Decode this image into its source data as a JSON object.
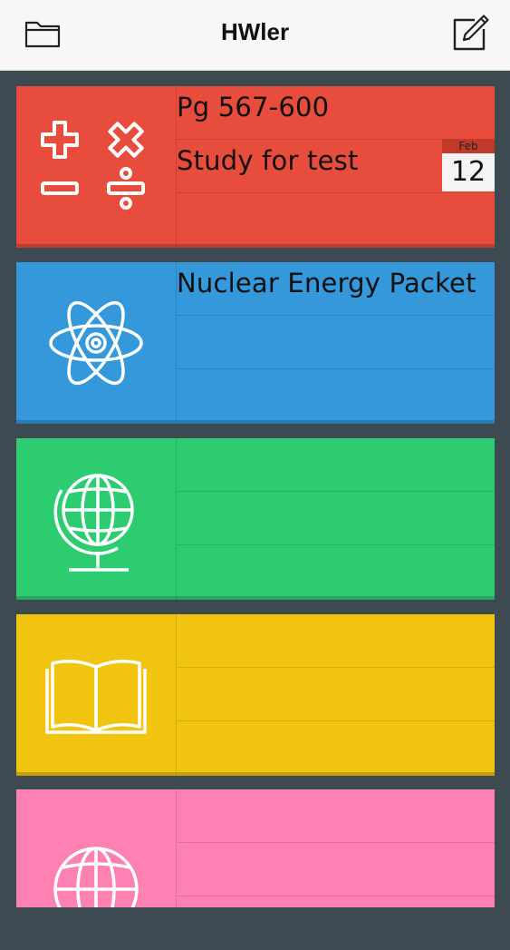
{
  "app": {
    "title": "HWler"
  },
  "toolbar": {
    "left_icon": "folder-icon",
    "right_icon": "compose-icon"
  },
  "subjects": [
    {
      "name": "math",
      "icon": "math-operators-icon",
      "color": "#e74c3c",
      "lines": [
        "Pg 567-600",
        "Study for test",
        ""
      ],
      "due": {
        "month": "Feb",
        "day": "12"
      }
    },
    {
      "name": "science",
      "icon": "atom-icon",
      "color": "#3498db",
      "lines": [
        "Nuclear Energy Packet",
        "",
        ""
      ]
    },
    {
      "name": "geography",
      "icon": "globe-stand-icon",
      "color": "#2ecc71",
      "lines": [
        "",
        "",
        ""
      ]
    },
    {
      "name": "reading",
      "icon": "open-book-icon",
      "color": "#f1c40f",
      "lines": [
        "",
        "",
        ""
      ]
    },
    {
      "name": "languages",
      "icon": "globe-icon",
      "color": "#ff80b3",
      "lines": [
        "",
        "",
        ""
      ]
    }
  ]
}
